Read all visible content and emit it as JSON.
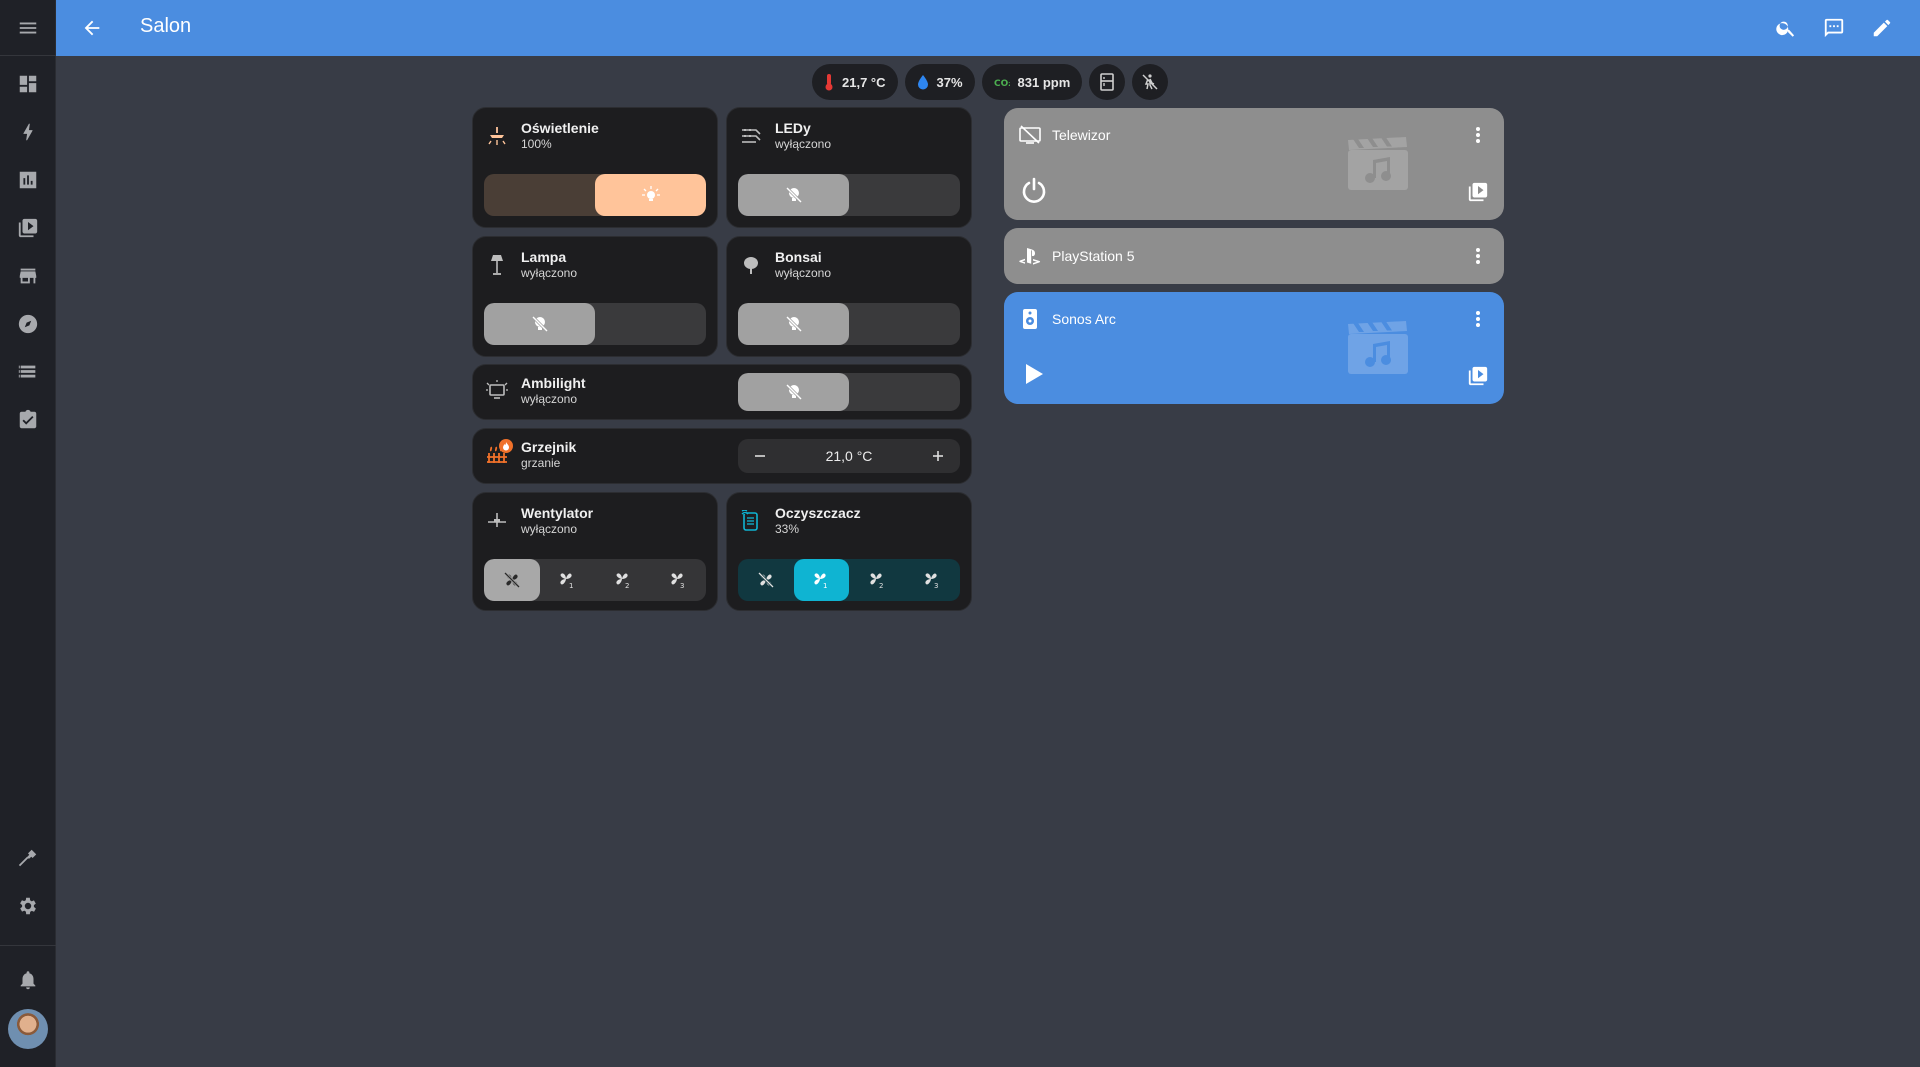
{
  "header": {
    "title": "Salon",
    "menu_icon": "menu-icon",
    "back_icon": "arrow-left-icon",
    "actions": [
      "search-icon",
      "assist-icon",
      "pencil-icon"
    ]
  },
  "sidebar": {
    "items": [
      "dashboard-icon",
      "energy-icon",
      "history-icon",
      "media-icon",
      "store-icon",
      "map-icon",
      "logbook-icon",
      "todo-icon"
    ],
    "bottom": [
      "developer-tools-icon",
      "settings-icon",
      "bell-icon"
    ]
  },
  "badges": {
    "temperature": "21,7 °C",
    "humidity": "37%",
    "co2": "831 ppm"
  },
  "tiles": {
    "oswietlenie": {
      "name": "Oświetlenie",
      "state": "100%"
    },
    "ledy": {
      "name": "LEDy",
      "state": "wyłączono"
    },
    "lampa": {
      "name": "Lampa",
      "state": "wyłączono"
    },
    "bonsai": {
      "name": "Bonsai",
      "state": "wyłączono"
    },
    "ambilight": {
      "name": "Ambilight",
      "state": "wyłączono"
    },
    "grzejnik": {
      "name": "Grzejnik",
      "state": "grzanie",
      "target": "21,0 °C"
    },
    "wentylator": {
      "name": "Wentylator",
      "state": "wyłączono"
    },
    "oczyszczacz": {
      "name": "Oczyszczacz",
      "state": "33%"
    }
  },
  "media": {
    "telewizor": {
      "name": "Telewizor"
    },
    "playstation": {
      "name": "PlayStation 5"
    },
    "sonos": {
      "name": "Sonos Arc"
    }
  },
  "colors": {
    "header": "#4b8de0",
    "light_on": "#ffc49a",
    "purifier": "#0fb4d2",
    "heat": "#f0712a",
    "media_idle": "#8e8e8e",
    "media_active": "#4b8de0"
  }
}
